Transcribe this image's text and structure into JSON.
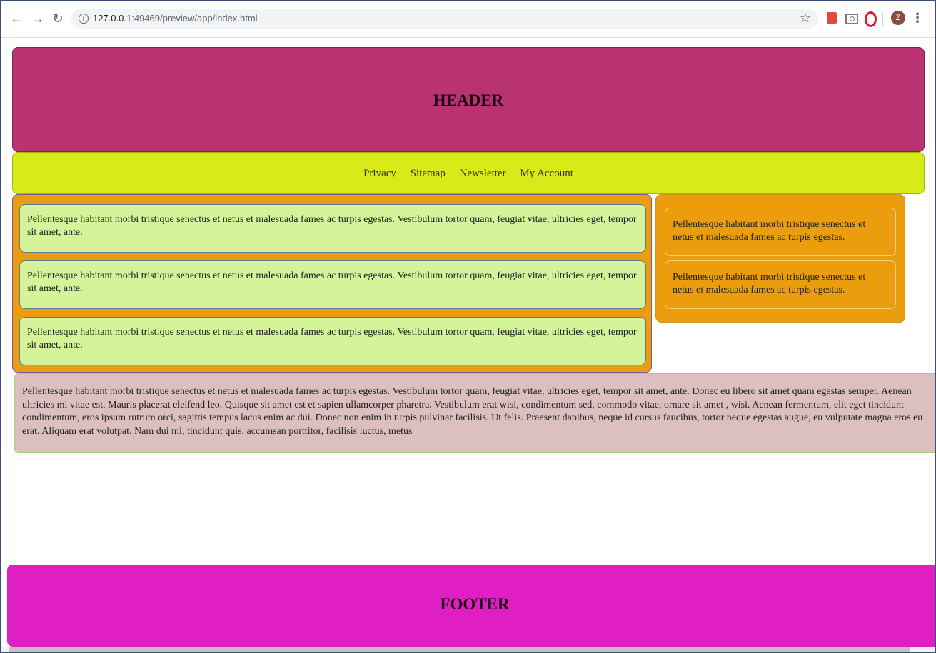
{
  "browser": {
    "url_host": "127.0.0.1",
    "url_rest": ":49469/preview/app/index.html",
    "avatar_letter": "Z",
    "icons": [
      "back-icon",
      "forward-icon",
      "reload-icon",
      "info-icon",
      "star-icon",
      "pdf-icon",
      "camera-icon",
      "opera-icon",
      "menu-icon"
    ]
  },
  "header": {
    "title": "HEADER"
  },
  "nav": {
    "items": [
      {
        "label": "Privacy"
      },
      {
        "label": "Sitemap"
      },
      {
        "label": "Newsletter"
      },
      {
        "label": "My Account"
      }
    ]
  },
  "main": {
    "cards": [
      {
        "text": "Pellentesque habitant morbi tristique senectus et netus et malesuada fames ac turpis egestas. Vestibulum tortor quam, feugiat vitae, ultricies eget, tempor sit amet, ante."
      },
      {
        "text": "Pellentesque habitant morbi tristique senectus et netus et malesuada fames ac turpis egestas. Vestibulum tortor quam, feugiat vitae, ultricies eget, tempor sit amet, ante."
      },
      {
        "text": "Pellentesque habitant morbi tristique senectus et netus et malesuada fames ac turpis egestas. Vestibulum tortor quam, feugiat vitae, ultricies eget, tempor sit amet, ante."
      }
    ]
  },
  "aside": {
    "cards": [
      {
        "text": "Pellentesque habitant morbi tristique senectus et netus et malesuada fames ac turpis egestas."
      },
      {
        "text": "Pellentesque habitant morbi tristique senectus et netus et malesuada fames ac turpis egestas."
      }
    ]
  },
  "article": {
    "text": "Pellentesque habitant morbi tristique senectus et netus et malesuada fames ac turpis egestas. Vestibulum tortor quam, feugiat vitae, ultricies eget, tempor sit amet, ante. Donec eu libero sit amet quam egestas semper. Aenean ultricies mi vitae est. Mauris placerat eleifend leo. Quisque sit amet est et sapien ullamcorper pharetra. Vestibulum erat wisi, condimentum sed, commodo vitae, ornare sit amet , wisi. Aenean fermentum, elit eget tincidunt condimentum, eros ipsum rutrum orci, sagittis tempus lacus enim ac dui. Donec non enim in turpis pulvinar facilisis. Ut felis. Praesent dapibus, neque id cursus faucibus, tortor neque egestas augue, eu vulputate magna eros eu erat. Aliquam erat volutpat. Nam dui mi, tincidunt quis, accumsan porttitor, facilisis luctus, metus"
  },
  "footer": {
    "title": "FOOTER"
  },
  "colors": {
    "header": "#b93372",
    "nav": "#d8ea17",
    "main": "#eb9d0d",
    "card_green": "#d5f49a",
    "article": "#dcc0c0",
    "footer": "#df1fc3"
  }
}
